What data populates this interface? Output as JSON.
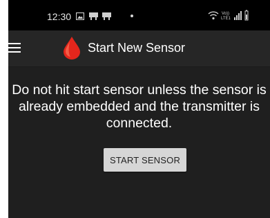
{
  "status_bar": {
    "time": "12:30",
    "icons": [
      "gallery-icon",
      "notification-icon",
      "notification-icon",
      "dot-icon",
      "wifi-icon",
      "volte-lte-icon",
      "signal-icon",
      "battery-icon"
    ],
    "network_badge_top": "Vo))",
    "network_badge_bottom": "LTE1"
  },
  "app_bar": {
    "title": "Start New Sensor",
    "menu_icon": "hamburger-menu-icon",
    "logo_icon": "blood-drop-icon",
    "logo_color": "#e4261c"
  },
  "main": {
    "message": "Do not hit start sensor unless the sensor is already embedded and the transmitter is connected.",
    "start_button_label": "START SENSOR"
  },
  "colors": {
    "background": "#1f1f1f",
    "status_bar": "#000000",
    "app_bar": "#262626",
    "button": "#d6d6d6"
  }
}
